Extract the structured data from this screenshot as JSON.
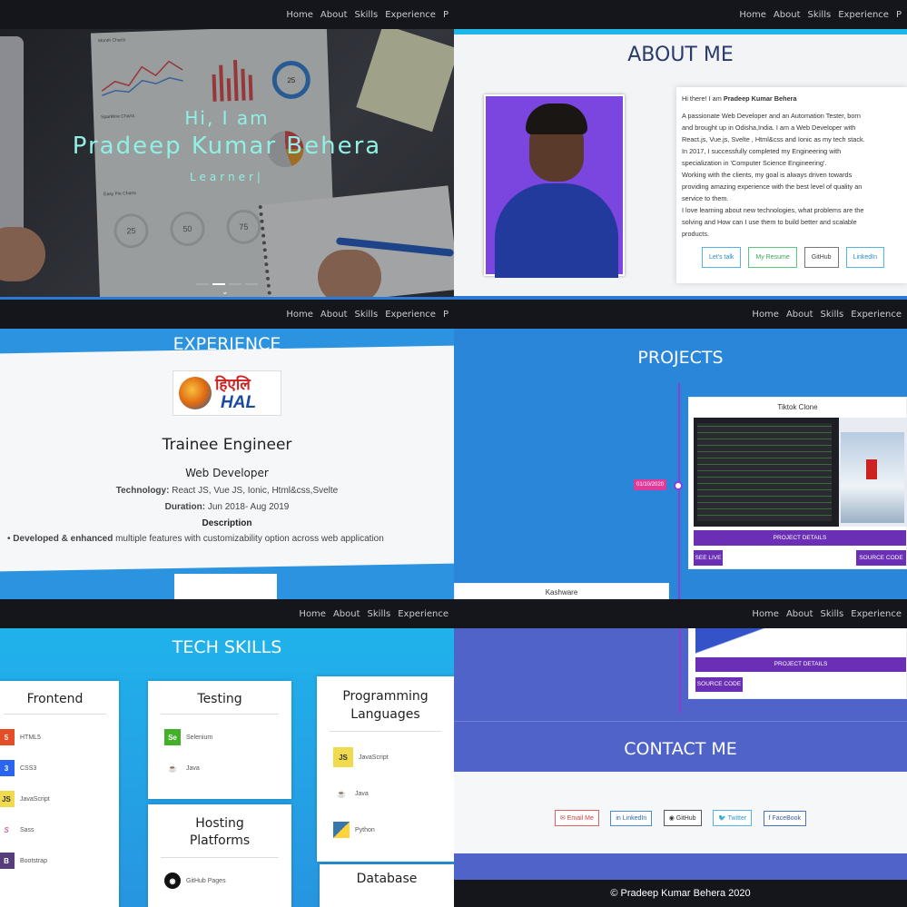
{
  "nav": {
    "home": "Home",
    "about": "About",
    "skills": "Skills",
    "experience": "Experience",
    "p": "P"
  },
  "hero": {
    "greeting": "Hi, I am",
    "name": "Pradeep Kumar Behera",
    "role": "Learner|"
  },
  "charts_paper": {
    "c1": "Month Charts",
    "c2": "Sparkline Charts",
    "c3": "Easy Pie Charts",
    "p1": "25",
    "p2": "50",
    "p3": "75",
    "p4": "25"
  },
  "about": {
    "title": "ABOUT ME",
    "hello": "Hi there! I am ",
    "name": "Pradeep Kumar Behera",
    "lines": [
      "A passionate Web Developer and an Automation Tester, born",
      "and brought up in Odisha,India. I am a Web Developer with",
      "React.js, Vue.js, Svelte , Html&css and Ionic as my tech stack.",
      "In 2017, I successfully completed my Engineering with",
      "specialization in 'Computer Science Engineering'.",
      "Working with the clients, my goal is always driven towards",
      "providing amazing experience with the best level of quality an",
      "service to them.",
      "I love learning about new technologies, what problems are the",
      "solving and How can I use them to build better and scalable",
      "products."
    ],
    "buttons": [
      "Let's talk",
      "My Resume",
      "GitHub",
      "LinkedIn"
    ]
  },
  "experience": {
    "title": "EXPERIENCE",
    "logo_text": "HAL",
    "logo_hindi": "हिएलि",
    "position": "Trainee Engineer",
    "subtitle": "Web Developer",
    "tech_label": "Technology:",
    "tech_value": " React JS, Vue JS, Ionic, Html&css,Svelte",
    "duration_label": "Duration:",
    "duration_value": " Jun 2018- Aug 2019",
    "desc_label": "Description",
    "bullet_bold": "Developed & enhanced",
    "bullet_rest": " multiple features with customizability option across web application"
  },
  "projects": {
    "title": "PROJECTS",
    "date": "01/10/2020",
    "card1_title": "Tiktok Clone",
    "details": "PROJECT DETAILS",
    "see_live": "SEE LIVE",
    "source": "SOURCE CODE",
    "card2_title": "Kashware"
  },
  "skills": {
    "title": "TECH SKILLS",
    "frontend": {
      "title": "Frontend",
      "items": [
        "HTML5",
        "CSS3",
        "JavaScript",
        "Sass",
        "Bootstrap"
      ]
    },
    "testing": {
      "title": "Testing",
      "items": [
        "Selenium",
        "Java"
      ]
    },
    "hosting": {
      "title_1": "Hosting",
      "title_2": "Platforms",
      "items": [
        "GitHub Pages"
      ]
    },
    "programming": {
      "title_1": "Programming",
      "title_2": "Languages",
      "items": [
        "JavaScript",
        "Java",
        "Python"
      ]
    },
    "database": {
      "title": "Database"
    }
  },
  "contact": {
    "details": "PROJECT DETAILS",
    "source": "SOURCE CODE",
    "title": "CONTACT ME",
    "buttons": [
      "Email Me",
      "LinkedIn",
      "GitHub",
      "Twitter",
      "FaceBook"
    ],
    "footer": "© Pradeep Kumar Behera   2020"
  },
  "colors": {
    "accent": "#1fb7e8",
    "purple": "#6a2fb5",
    "nav": "#14161c",
    "hero_text": "#8ff0e3"
  }
}
